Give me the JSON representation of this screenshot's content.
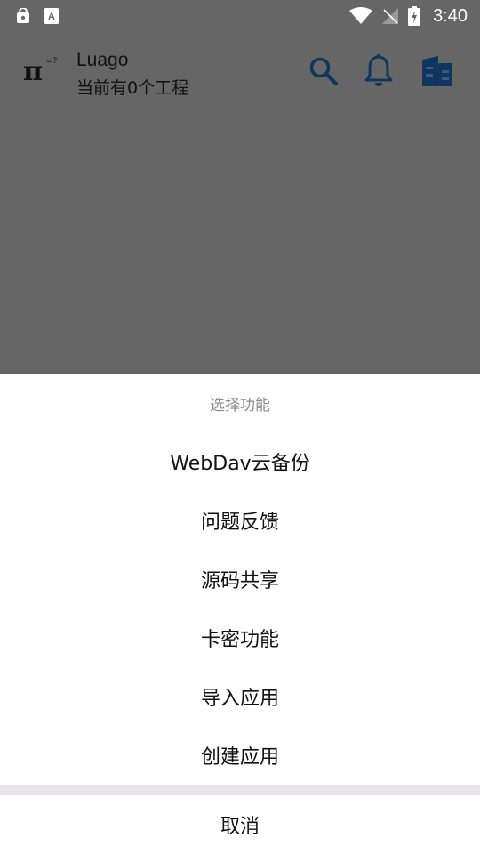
{
  "status_bar": {
    "time": "3:40",
    "left_icons": [
      "lock-badge-icon",
      "font-a-icon"
    ],
    "right_icons": [
      "wifi-icon",
      "no-signal-icon",
      "battery-charging-icon"
    ]
  },
  "app_bar": {
    "logo_text": "π",
    "logo_superscript": "=?",
    "title": "Luago",
    "subtitle": "当前有0个工程",
    "actions": [
      "search-icon",
      "bell-icon",
      "apps-panel-icon"
    ],
    "accent_color": "#10365f"
  },
  "sheet": {
    "title": "选择功能",
    "items": [
      {
        "label": "WebDav云备份"
      },
      {
        "label": "问题反馈"
      },
      {
        "label": "源码共享"
      },
      {
        "label": "卡密功能"
      },
      {
        "label": "导入应用"
      },
      {
        "label": "创建应用"
      }
    ],
    "cancel": "取消"
  },
  "colors": {
    "scrim": "#666666",
    "sheet_bg": "#ffffff",
    "divider": "#e6e4e6",
    "sheet_title": "#8a8a8a"
  }
}
